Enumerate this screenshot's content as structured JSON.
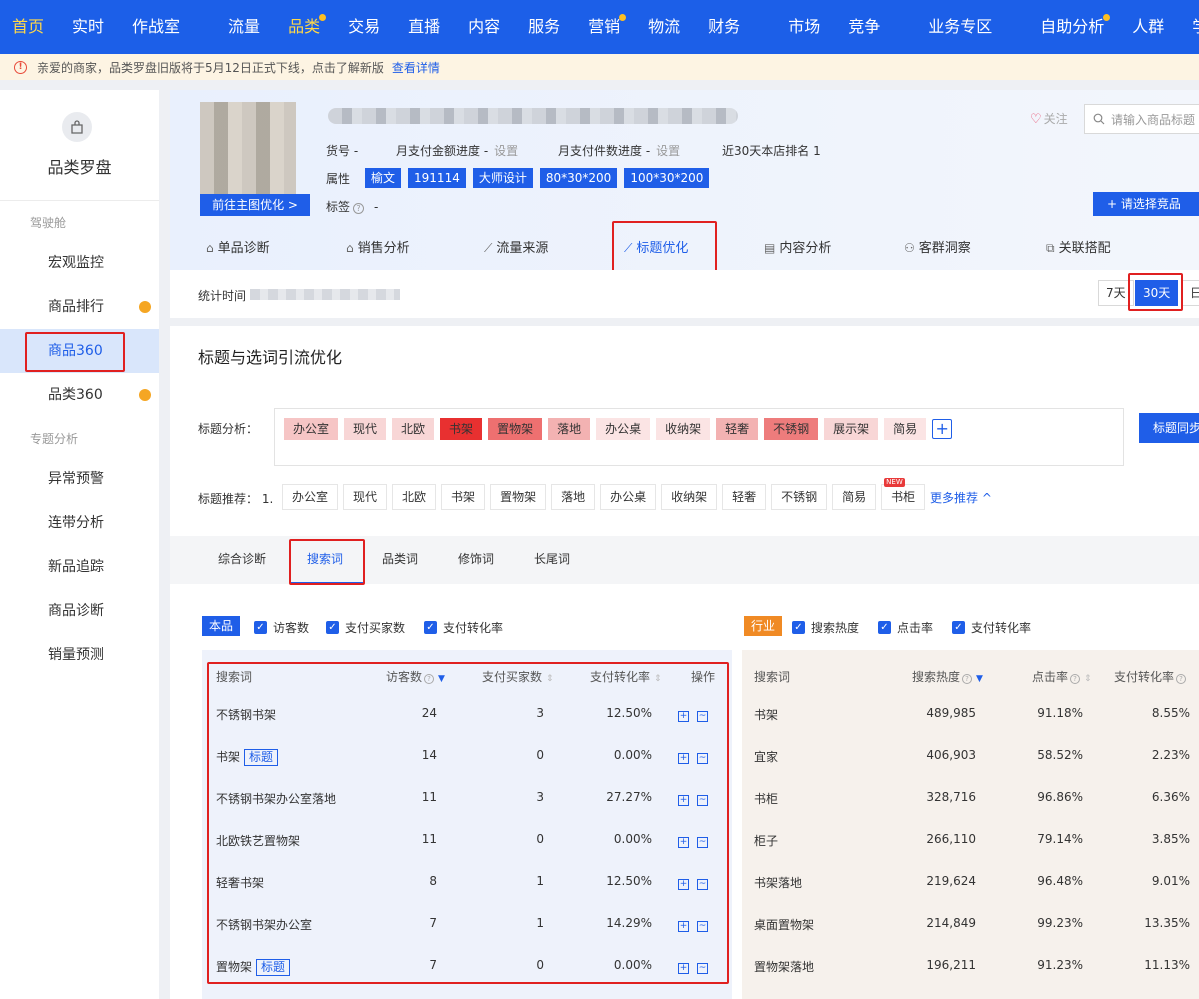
{
  "topnav": {
    "items": [
      "首页",
      "实时",
      "作战室",
      "流量",
      "品类",
      "交易",
      "直播",
      "内容",
      "服务",
      "营销",
      "物流",
      "财务",
      "市场",
      "竞争",
      "业务专区",
      "自助分析",
      "人群",
      "学"
    ]
  },
  "notice": {
    "text": "亲爱的商家，品类罗盘旧版将于5月12日正式下线，点击了解新版",
    "link": "查看详情"
  },
  "sidebar": {
    "title": "品类罗盘",
    "group1": "驾驶舱",
    "group2": "专题分析",
    "items": [
      "宏观监控",
      "商品排行",
      "商品360",
      "品类360",
      "异常预警",
      "连带分析",
      "新品追踪",
      "商品诊断",
      "销量预测"
    ]
  },
  "product": {
    "thumb_button": "前往主图优化 >",
    "sku_label": "货号 -",
    "pay_amount": "月支付金额进度 -",
    "pay_amount_set": "设置",
    "pay_count": "月支付件数进度 -",
    "pay_count_set": "设置",
    "rank": "近30天本店排名 1",
    "attr_label": "属性",
    "attrs": [
      "榆文",
      "191114",
      "大师设计",
      "80*30*200",
      "100*30*200"
    ],
    "tag_label": "标签",
    "tag_value": "-",
    "follow": "关注",
    "search_placeholder": "请输入商品标题",
    "compare_button": "+ 请选择竞品"
  },
  "tabs": [
    "单品诊断",
    "销售分析",
    "流量来源",
    "标题优化",
    "内容分析",
    "客群洞察",
    "关联搭配"
  ],
  "stats": {
    "label": "统计时间",
    "ranges": [
      "7天",
      "30天",
      "日"
    ]
  },
  "section": {
    "title": "标题与选词引流优化",
    "title_analysis_label": "标题分析：",
    "title_chips": [
      {
        "text": "办公室",
        "color": "#f6c5c5"
      },
      {
        "text": "现代",
        "color": "#f8d6d6"
      },
      {
        "text": "北欧",
        "color": "#f8d6d6"
      },
      {
        "text": "书架",
        "color": "#e83030"
      },
      {
        "text": "置物架",
        "color": "#ee7070"
      },
      {
        "text": "落地",
        "color": "#f3b2b2"
      },
      {
        "text": "办公桌",
        "color": "#fbe4e4"
      },
      {
        "text": "收纳架",
        "color": "#fbe4e4"
      },
      {
        "text": "轻奢",
        "color": "#f3b2b2"
      },
      {
        "text": "不锈钢",
        "color": "#ee7c7c"
      },
      {
        "text": "展示架",
        "color": "#f8d6d6"
      },
      {
        "text": "简易",
        "color": "#fbe4e4"
      }
    ],
    "sync_button": "标题同步",
    "rec_label": "标题推荐：",
    "rec_index": "1.",
    "rec_chips": [
      "办公室",
      "现代",
      "北欧",
      "书架",
      "置物架",
      "落地",
      "办公桌",
      "收纳架",
      "轻奢",
      "不锈钢",
      "简易",
      "书柜"
    ],
    "new_badge": "NEW",
    "more": "更多推荐 ^"
  },
  "subtabs": [
    "综合诊断",
    "搜索词",
    "品类词",
    "修饰词",
    "长尾词"
  ],
  "left_table": {
    "badge": "本品",
    "checks": [
      "访客数",
      "支付买家数",
      "支付转化率"
    ],
    "headers": [
      "搜索词",
      "访客数",
      "支付买家数",
      "支付转化率",
      "操作"
    ],
    "title_tag": "标题",
    "rows": [
      {
        "word": "不锈钢书架",
        "tag": false,
        "visitors": "24",
        "buyers": "3",
        "rate": "12.50%"
      },
      {
        "word": "书架",
        "tag": true,
        "visitors": "14",
        "buyers": "0",
        "rate": "0.00%"
      },
      {
        "word": "不锈钢书架办公室落地",
        "tag": false,
        "visitors": "11",
        "buyers": "3",
        "rate": "27.27%"
      },
      {
        "word": "北欧铁艺置物架",
        "tag": false,
        "visitors": "11",
        "buyers": "0",
        "rate": "0.00%"
      },
      {
        "word": "轻奢书架",
        "tag": false,
        "visitors": "8",
        "buyers": "1",
        "rate": "12.50%"
      },
      {
        "word": "不锈钢书架办公室",
        "tag": false,
        "visitors": "7",
        "buyers": "1",
        "rate": "14.29%"
      },
      {
        "word": "置物架",
        "tag": true,
        "visitors": "7",
        "buyers": "0",
        "rate": "0.00%"
      }
    ]
  },
  "right_table": {
    "badge": "行业",
    "checks": [
      "搜索热度",
      "点击率",
      "支付转化率"
    ],
    "headers": [
      "搜索词",
      "搜索热度",
      "点击率",
      "支付转化率"
    ],
    "rows": [
      {
        "word": "书架",
        "heat": "489,985",
        "ctr": "91.18%",
        "rate": "8.55%"
      },
      {
        "word": "宜家",
        "heat": "406,903",
        "ctr": "58.52%",
        "rate": "2.23%"
      },
      {
        "word": "书柜",
        "heat": "328,716",
        "ctr": "96.86%",
        "rate": "6.36%"
      },
      {
        "word": "柜子",
        "heat": "266,110",
        "ctr": "79.14%",
        "rate": "3.85%"
      },
      {
        "word": "书架落地",
        "heat": "219,624",
        "ctr": "96.48%",
        "rate": "9.01%"
      },
      {
        "word": "桌面置物架",
        "heat": "214,849",
        "ctr": "99.23%",
        "rate": "13.35%"
      },
      {
        "word": "置物架落地",
        "heat": "196,211",
        "ctr": "91.23%",
        "rate": "11.13%"
      }
    ]
  }
}
